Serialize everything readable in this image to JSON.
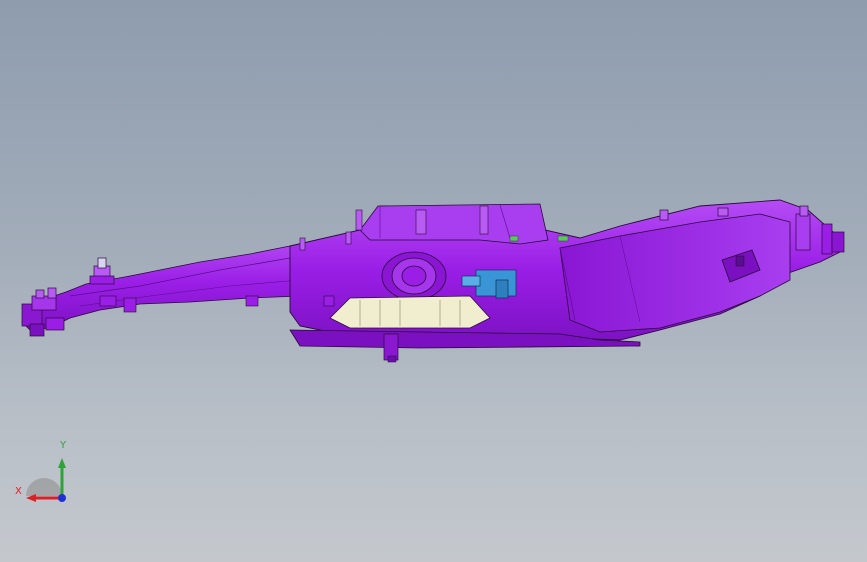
{
  "viewport": {
    "background_top": "#8e9cae",
    "background_bottom": "#c4c8cd"
  },
  "model": {
    "body_color": "#9a1ee6",
    "edge_color": "#2a0a3a",
    "insert_color": "#f1eed0",
    "bracket_color": "#3a95d6"
  },
  "triad": {
    "y_label": "Y",
    "x_label": "X",
    "x_color": "#d8222a",
    "y_color": "#2da33a",
    "z_color": "#2030d0"
  }
}
